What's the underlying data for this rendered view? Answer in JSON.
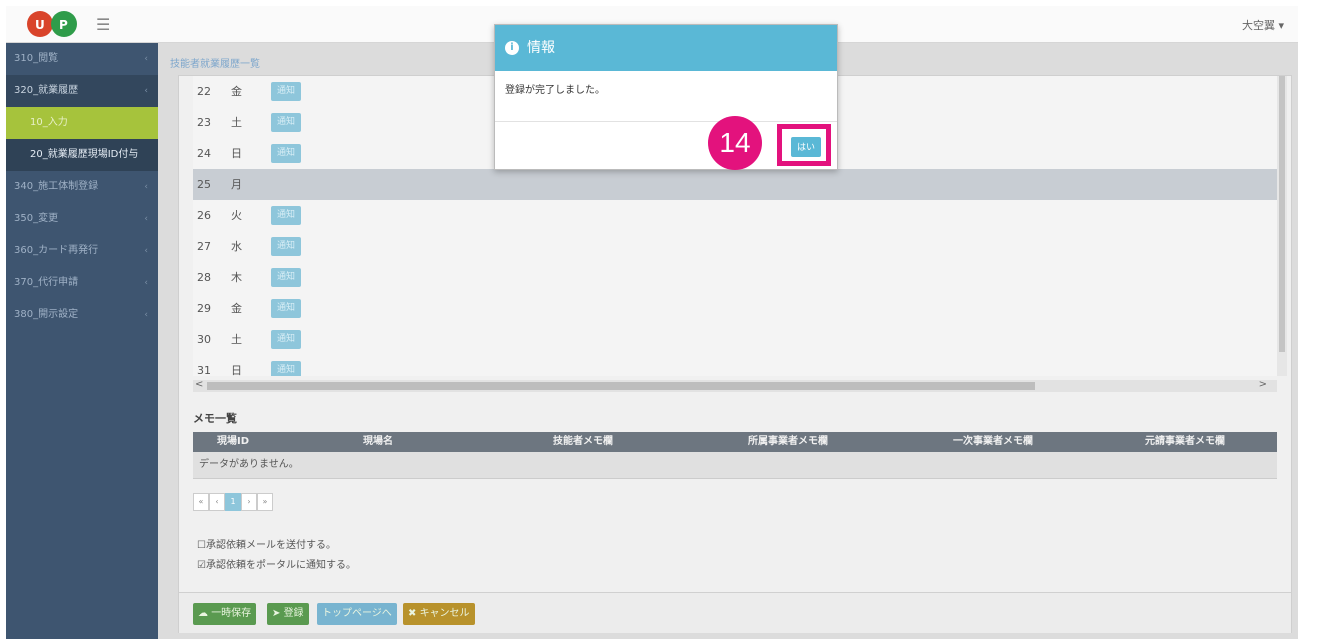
{
  "user": {
    "name": "大空翼 ▾"
  },
  "sidebar": {
    "items": [
      {
        "label": "310_閲覧",
        "chevron": "‹"
      },
      {
        "label": "320_就業履歴",
        "chevron": "‹"
      },
      {
        "label": "10_入力"
      },
      {
        "label": "20_就業履歴現場ID付与"
      },
      {
        "label": "340_施工体制登録",
        "chevron": "‹"
      },
      {
        "label": "350_変更",
        "chevron": "‹"
      },
      {
        "label": "360_カード再発行",
        "chevron": "‹"
      },
      {
        "label": "370_代行申請",
        "chevron": "‹"
      },
      {
        "label": "380_開示設定",
        "chevron": "‹"
      }
    ]
  },
  "breadcrumb": "技能者就業履歴一覧",
  "day_rows": [
    {
      "day": "22",
      "dow": "金",
      "button": "通知"
    },
    {
      "day": "23",
      "dow": "土",
      "button": "通知"
    },
    {
      "day": "24",
      "dow": "日",
      "button": "通知"
    },
    {
      "day": "25",
      "dow": "月",
      "button": ""
    },
    {
      "day": "26",
      "dow": "火",
      "button": "通知"
    },
    {
      "day": "27",
      "dow": "水",
      "button": "通知"
    },
    {
      "day": "28",
      "dow": "木",
      "button": "通知"
    },
    {
      "day": "29",
      "dow": "金",
      "button": "通知"
    },
    {
      "day": "30",
      "dow": "土",
      "button": "通知"
    },
    {
      "day": "31",
      "dow": "日",
      "button": "通知"
    }
  ],
  "scroll": {
    "left": "<",
    "right": ">"
  },
  "memo": {
    "title": "メモ一覧",
    "headers": [
      "現場ID",
      "現場名",
      "技能者メモ欄",
      "所属事業者メモ欄",
      "一次事業者メモ欄",
      "元請事業者メモ欄"
    ],
    "empty": "データがありません。"
  },
  "pager": {
    "first": "«",
    "prev": "‹",
    "page": "1",
    "next": "›",
    "last": "»"
  },
  "checkboxes": [
    {
      "label": "☐承認依頼メールを送付する。"
    },
    {
      "label": "☑承認依頼をポータルに通知する。"
    }
  ],
  "actions": {
    "temp_save": "一時保存",
    "register": "登録",
    "top_page": "トップページへ",
    "cancel": "キャンセル"
  },
  "modal": {
    "title": "情報",
    "message": "登録が完了しました。",
    "yes": "はい"
  },
  "step_number": "14",
  "colors": {
    "accent": "#5ab8d6",
    "highlight": "#e3127d",
    "sidebar": "#3e5570"
  }
}
